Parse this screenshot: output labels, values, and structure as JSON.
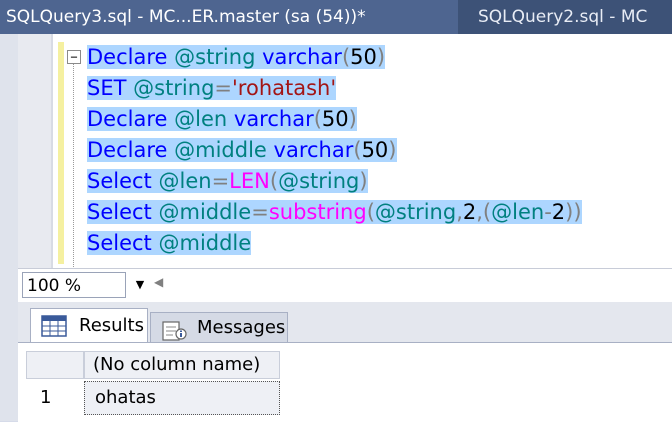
{
  "tabs": [
    {
      "label": "SQLQuery3.sql - MC...ER.master (sa (54))*",
      "active": true
    },
    {
      "label": "SQLQuery2.sql - MC",
      "active": false
    }
  ],
  "editor": {
    "collapse_glyph": "−",
    "lines": [
      [
        {
          "t": "Declare",
          "c": "kw"
        },
        {
          "t": " ",
          "c": ""
        },
        {
          "t": "@string",
          "c": "var"
        },
        {
          "t": " ",
          "c": ""
        },
        {
          "t": "varchar",
          "c": "kw"
        },
        {
          "t": "(",
          "c": "punc"
        },
        {
          "t": "50",
          "c": "num"
        },
        {
          "t": ")",
          "c": "punc"
        }
      ],
      [
        {
          "t": "SET",
          "c": "kw"
        },
        {
          "t": " ",
          "c": ""
        },
        {
          "t": "@string",
          "c": "var"
        },
        {
          "t": "=",
          "c": "punc"
        },
        {
          "t": "'rohatash'",
          "c": "str"
        }
      ],
      [
        {
          "t": "Declare",
          "c": "kw"
        },
        {
          "t": " ",
          "c": ""
        },
        {
          "t": "@len",
          "c": "var"
        },
        {
          "t": " ",
          "c": ""
        },
        {
          "t": "varchar",
          "c": "kw"
        },
        {
          "t": "(",
          "c": "punc"
        },
        {
          "t": "50",
          "c": "num"
        },
        {
          "t": ")",
          "c": "punc"
        }
      ],
      [
        {
          "t": "Declare",
          "c": "kw"
        },
        {
          "t": " ",
          "c": ""
        },
        {
          "t": "@middle",
          "c": "var"
        },
        {
          "t": " ",
          "c": ""
        },
        {
          "t": "varchar",
          "c": "kw"
        },
        {
          "t": "(",
          "c": "punc"
        },
        {
          "t": "50",
          "c": "num"
        },
        {
          "t": ")",
          "c": "punc"
        }
      ],
      [
        {
          "t": "Select",
          "c": "kw"
        },
        {
          "t": " ",
          "c": ""
        },
        {
          "t": "@len",
          "c": "var"
        },
        {
          "t": "=",
          "c": "punc"
        },
        {
          "t": "LEN",
          "c": "fn"
        },
        {
          "t": "(",
          "c": "punc"
        },
        {
          "t": "@string",
          "c": "var"
        },
        {
          "t": ")",
          "c": "punc"
        }
      ],
      [
        {
          "t": "Select",
          "c": "kw"
        },
        {
          "t": " ",
          "c": ""
        },
        {
          "t": "@middle",
          "c": "var"
        },
        {
          "t": "=",
          "c": "punc"
        },
        {
          "t": "substring",
          "c": "fn"
        },
        {
          "t": "(",
          "c": "punc"
        },
        {
          "t": "@string",
          "c": "var"
        },
        {
          "t": ",",
          "c": "punc"
        },
        {
          "t": "2",
          "c": "num"
        },
        {
          "t": ",(",
          "c": "punc"
        },
        {
          "t": "@len",
          "c": "var"
        },
        {
          "t": "-",
          "c": "punc"
        },
        {
          "t": "2",
          "c": "num"
        },
        {
          "t": "))",
          "c": "punc"
        }
      ],
      [
        {
          "t": "Select",
          "c": "kw"
        },
        {
          "t": " ",
          "c": ""
        },
        {
          "t": "@middle",
          "c": "var"
        }
      ]
    ]
  },
  "zoom": {
    "value": "100 %"
  },
  "results": {
    "tabs": [
      {
        "label": "Results",
        "active": true
      },
      {
        "label": "Messages",
        "active": false
      }
    ],
    "grid": {
      "columns": [
        "(No column name)"
      ],
      "rows": [
        {
          "rownum": "1",
          "cells": [
            "ohatas"
          ]
        }
      ]
    }
  },
  "colors": {
    "keyword": "#0000ff",
    "function": "#ff00ff",
    "string": "#a31515",
    "variable": "#008080",
    "selection": "#add6ff"
  }
}
